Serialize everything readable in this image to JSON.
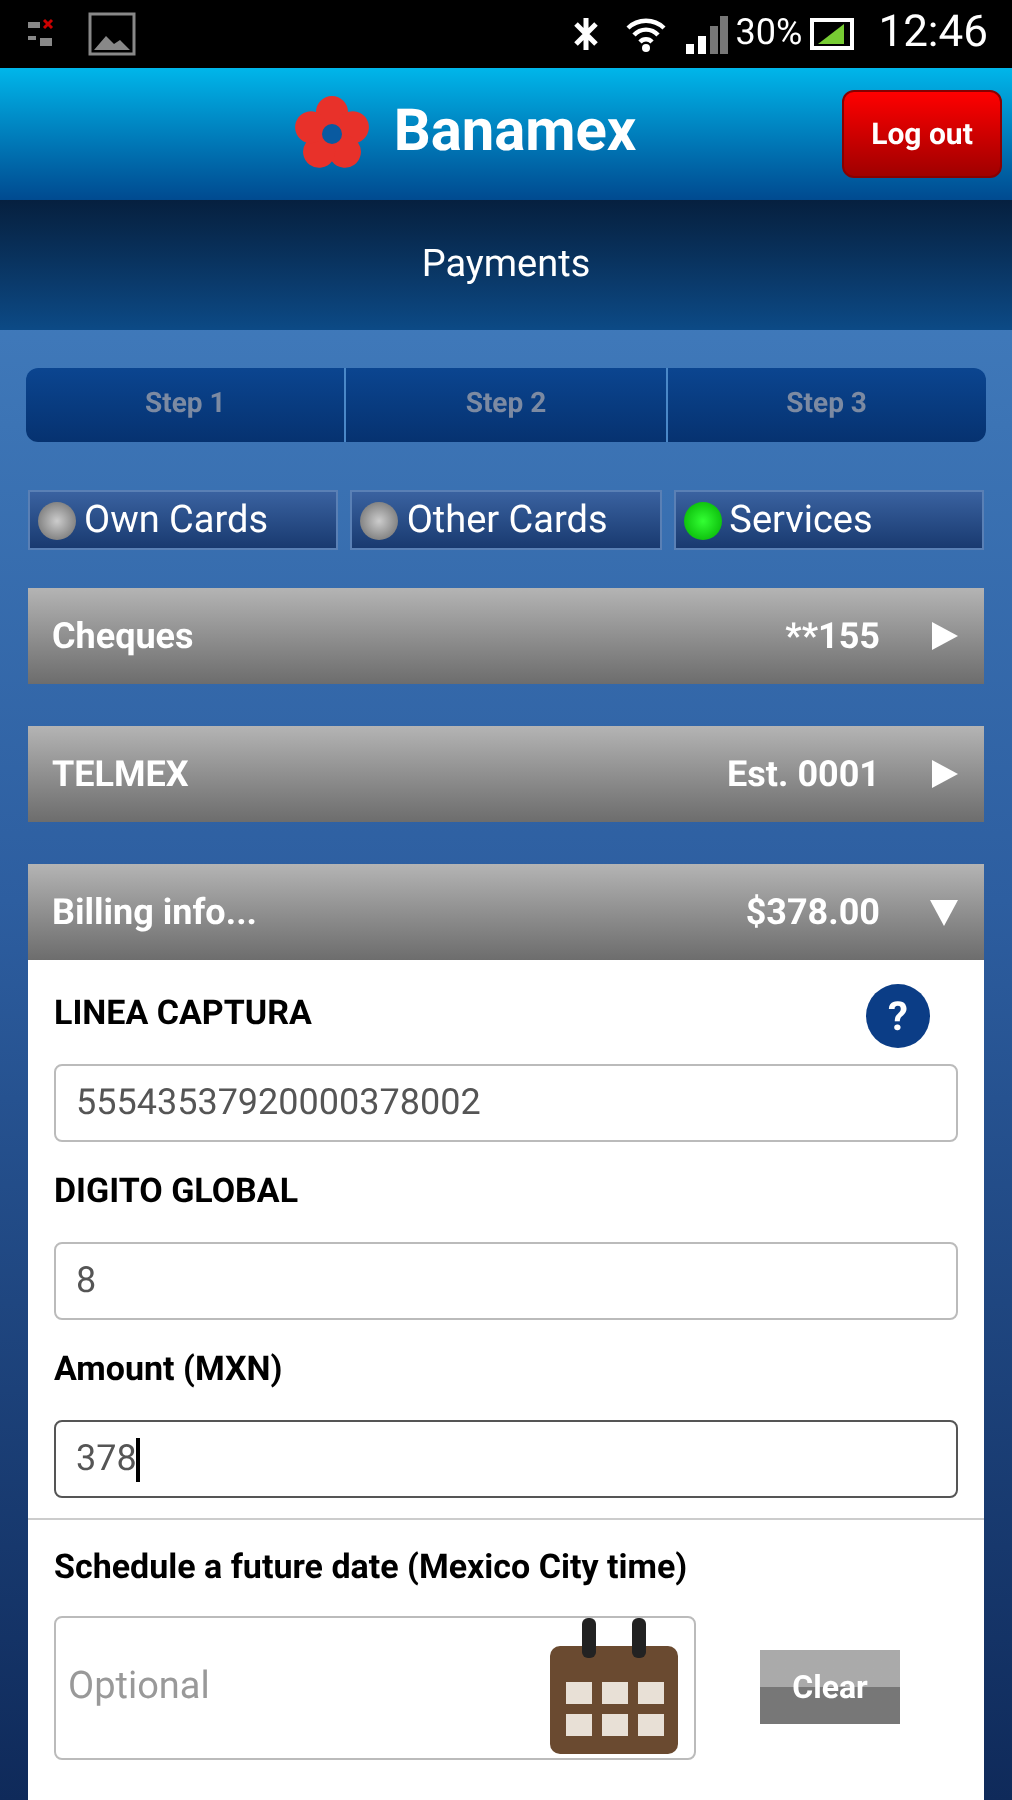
{
  "status_bar": {
    "battery": "30%",
    "time": "12:46"
  },
  "header": {
    "brand": "Banamex",
    "logout": "Log out"
  },
  "title": "Payments",
  "steps": [
    {
      "label": "Step 1"
    },
    {
      "label": "Step 2"
    },
    {
      "label": "Step 3"
    }
  ],
  "tabs": [
    {
      "label": "Own Cards",
      "selected": false
    },
    {
      "label": "Other Cards",
      "selected": false
    },
    {
      "label": "Services",
      "selected": true
    }
  ],
  "sections": [
    {
      "label": "Cheques",
      "value": "**155",
      "expanded": false
    },
    {
      "label": "TELMEX",
      "value": "Est. 0001",
      "expanded": false
    },
    {
      "label": "Billing info...",
      "value": "$378.00",
      "expanded": true
    }
  ],
  "form": {
    "fields": [
      {
        "label": "LINEA CAPTURA",
        "value": "55543537920000378002",
        "help": "?",
        "focused": false
      },
      {
        "label": "DIGITO GLOBAL",
        "value": "8",
        "focused": false
      },
      {
        "label": "Amount (MXN)",
        "value": "378",
        "focused": true
      }
    ],
    "schedule": {
      "label": "Schedule a future date (Mexico City time)",
      "placeholder": "Optional",
      "clear": "Clear"
    }
  }
}
